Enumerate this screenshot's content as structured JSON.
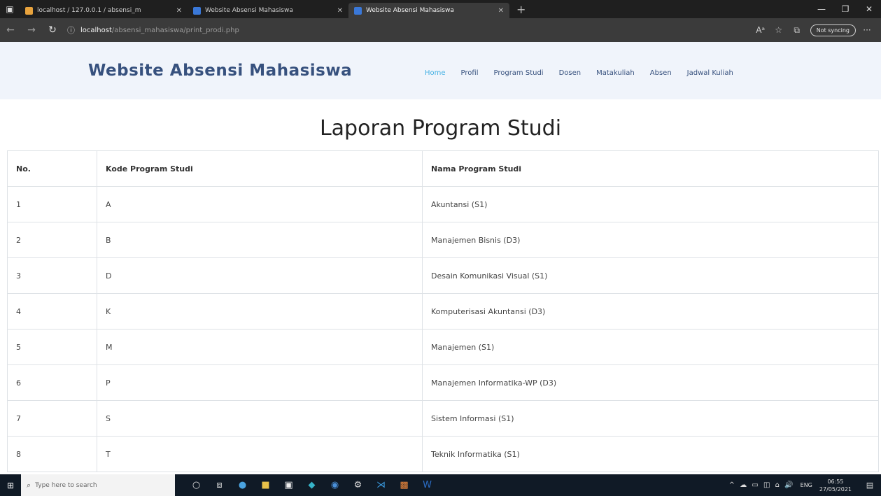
{
  "browser": {
    "tabs": [
      {
        "title": "localhost / 127.0.0.1 / absensi_m",
        "active": false,
        "favicon_color": "#e8a33d"
      },
      {
        "title": "Website Absensi Mahasiswa",
        "active": false,
        "favicon_color": "#3a78d8"
      },
      {
        "title": "Website Absensi Mahasiswa",
        "active": true,
        "favicon_color": "#3a78d8"
      }
    ],
    "url_host": "localhost",
    "url_path": "/absensi_mahasiswa/print_prodi.php",
    "sync_label": "Not syncing",
    "icons": {
      "back": "back-arrow-icon",
      "forward": "forward-arrow-icon",
      "reload": "reload-icon",
      "info": "info-icon"
    }
  },
  "site": {
    "brand": "Website Absensi Mahasiswa",
    "nav": [
      "Home",
      "Profil",
      "Program Studi",
      "Dosen",
      "Matakuliah",
      "Absen",
      "Jadwal Kuliah"
    ],
    "active_nav": "Home",
    "colors": {
      "brand": "#37517e",
      "active": "#47b2e4",
      "header_bg": "#f0f4fb"
    }
  },
  "report": {
    "title": "Laporan Program Studi",
    "headers": [
      "No.",
      "Kode Program Studi",
      "Nama Program Studi"
    ],
    "rows": [
      [
        "1",
        "A",
        "Akuntansi (S1)"
      ],
      [
        "2",
        "B",
        "Manajemen Bisnis (D3)"
      ],
      [
        "3",
        "D",
        "Desain Komunikasi Visual (S1)"
      ],
      [
        "4",
        "K",
        "Komputerisasi Akuntansi (D3)"
      ],
      [
        "5",
        "M",
        "Manajemen (S1)"
      ],
      [
        "6",
        "P",
        "Manajemen Informatika-WP (D3)"
      ],
      [
        "7",
        "S",
        "Sistem Informasi (S1)"
      ],
      [
        "8",
        "T",
        "Teknik Informatika (S1)"
      ]
    ]
  },
  "taskbar": {
    "search_placeholder": "Type here to search",
    "language": "ENG",
    "time": "06:55",
    "date": "27/05/2021"
  }
}
